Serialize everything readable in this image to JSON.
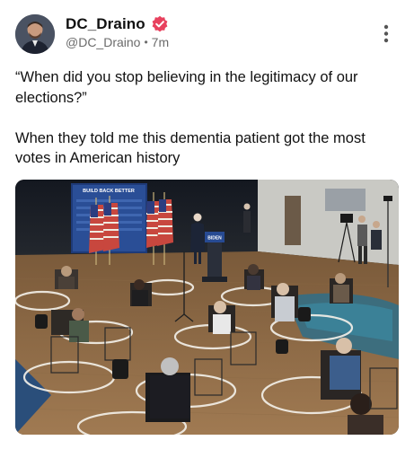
{
  "post": {
    "author": {
      "display_name": "DC_Draino",
      "handle": "@DC_Draino",
      "timestamp": "7m",
      "verified_icon": "verified-badge-icon",
      "verified_color": "#e8415e"
    },
    "more_icon": "more-vertical-icon",
    "text": {
      "paragraph_1": "“When did you stop believing in the legitimacy of our elections?”",
      "paragraph_2": "When they told me this dementia patient got the most votes in American history"
    },
    "media": {
      "banner_text": "BUILD BACK BETTER",
      "podium_text": "BIDEN"
    }
  }
}
